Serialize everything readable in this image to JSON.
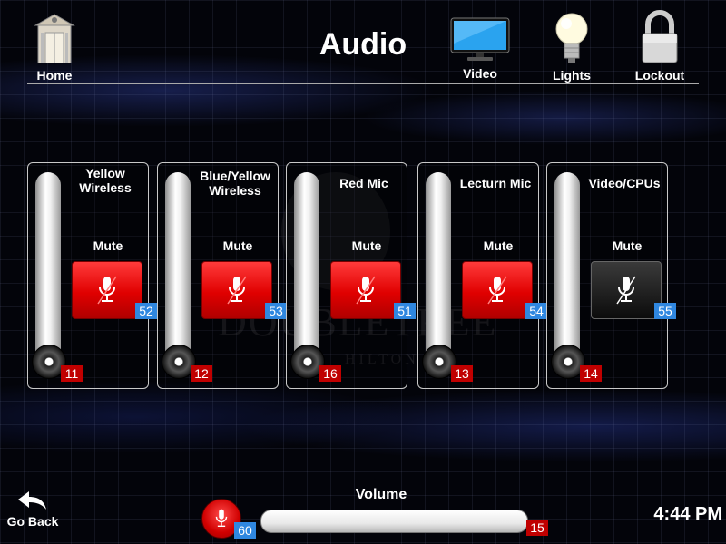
{
  "header": {
    "title": "Audio"
  },
  "nav": {
    "home": {
      "label": "Home",
      "icon": "home-icon"
    },
    "video": {
      "label": "Video",
      "icon": "monitor-icon"
    },
    "lights": {
      "label": "Lights",
      "icon": "lightbulb-icon"
    },
    "lockout": {
      "label": "Lockout",
      "icon": "padlock-icon"
    }
  },
  "watermark": {
    "text": "DOUBLETREE",
    "subtext": "HILTON"
  },
  "channels": [
    {
      "name": "Yellow Wireless",
      "mute_label": "Mute",
      "mute_id": "52",
      "fader_id": "11",
      "muted": true,
      "level": 0
    },
    {
      "name": "Blue/Yellow Wireless",
      "mute_label": "Mute",
      "mute_id": "53",
      "fader_id": "12",
      "muted": true,
      "level": 0
    },
    {
      "name": "Red Mic",
      "mute_label": "Mute",
      "mute_id": "51",
      "fader_id": "16",
      "muted": true,
      "level": 0
    },
    {
      "name": "Lecturn Mic",
      "mute_label": "Mute",
      "mute_id": "54",
      "fader_id": "13",
      "muted": true,
      "level": 0
    },
    {
      "name": "Video/CPUs",
      "mute_label": "Mute",
      "mute_id": "55",
      "fader_id": "14",
      "muted": false,
      "level": 0
    }
  ],
  "volume": {
    "label": "Volume",
    "mute_id": "60",
    "bar_id": "15"
  },
  "footer": {
    "go_back": "Go Back",
    "time": "4:44 PM"
  },
  "colors": {
    "mute_active": "#e00000",
    "badge_blue": "#2f87e0",
    "badge_red": "#c00000"
  }
}
